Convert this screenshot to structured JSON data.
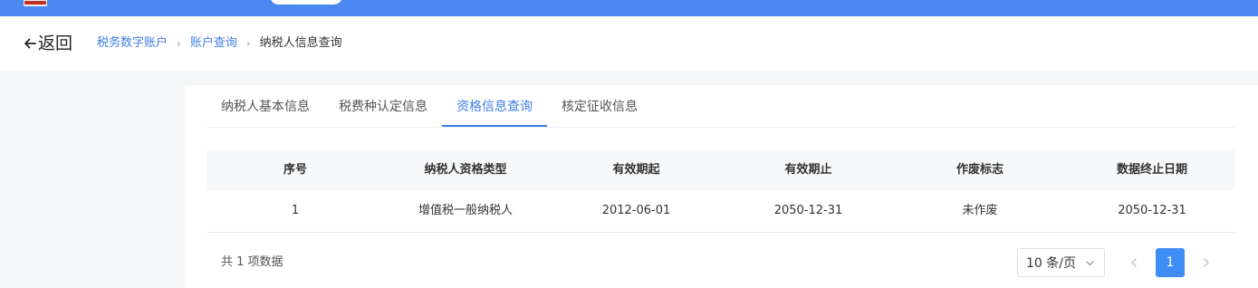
{
  "header": {
    "back_label": "返回",
    "breadcrumb": [
      {
        "label": "税务数字账户"
      },
      {
        "label": "账户查询"
      },
      {
        "label": "纳税人信息查询"
      }
    ]
  },
  "tabs": [
    {
      "label": "纳税人基本信息",
      "active": false
    },
    {
      "label": "税费种认定信息",
      "active": false
    },
    {
      "label": "资格信息查询",
      "active": true
    },
    {
      "label": "核定征收信息",
      "active": false
    }
  ],
  "table": {
    "columns": [
      "序号",
      "纳税人资格类型",
      "有效期起",
      "有效期止",
      "作废标志",
      "数据终止日期"
    ],
    "rows": [
      [
        "1",
        "增值税一般纳税人",
        "2012-06-01",
        "2050-12-31",
        "未作废",
        "2050-12-31"
      ]
    ]
  },
  "pagination": {
    "total_text": "共 1 项数据",
    "page_size": "10 条/页",
    "current_page": "1"
  },
  "colors": {
    "topbar": "#4b87f0",
    "accent": "#3f7fe6",
    "active_page_bg": "#3f8df5"
  }
}
